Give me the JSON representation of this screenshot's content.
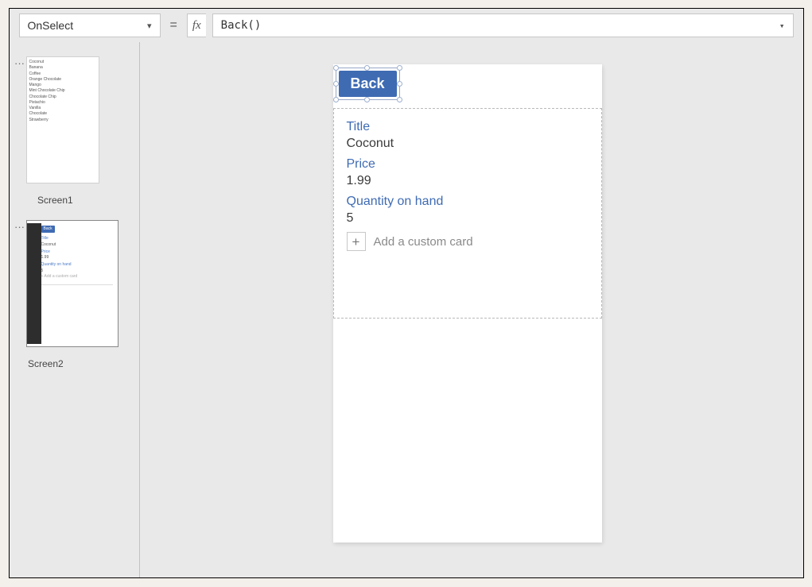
{
  "formula_bar": {
    "property": "OnSelect",
    "equals": "=",
    "fx": "fx",
    "expression": "Back()"
  },
  "sidebar": {
    "ellipsis": "···",
    "thumb1": {
      "caption": "Screen1",
      "items": [
        "Coconut",
        "Banana",
        "Coffee",
        "Orange Chocolate",
        "Mango",
        "Mint Chocolate Chip",
        "Chocolate Chip",
        "Pistachio",
        "Vanilla",
        "Chocolate",
        "Strawberry"
      ]
    },
    "thumb2": {
      "caption": "Screen2",
      "back": "Back",
      "title_lbl": "Title",
      "title_val": "Coconut",
      "price_lbl": "Price",
      "price_val": "1.99",
      "qty_lbl": "Quantity on hand",
      "qty_val": "5",
      "add": "+  Add a custom card"
    }
  },
  "canvas": {
    "back_label": "Back",
    "cards": {
      "title_lbl": "Title",
      "title_val": "Coconut",
      "price_lbl": "Price",
      "price_val": "1.99",
      "qty_lbl": "Quantity on hand",
      "qty_val": "5"
    },
    "add_card": "Add a custom card"
  }
}
